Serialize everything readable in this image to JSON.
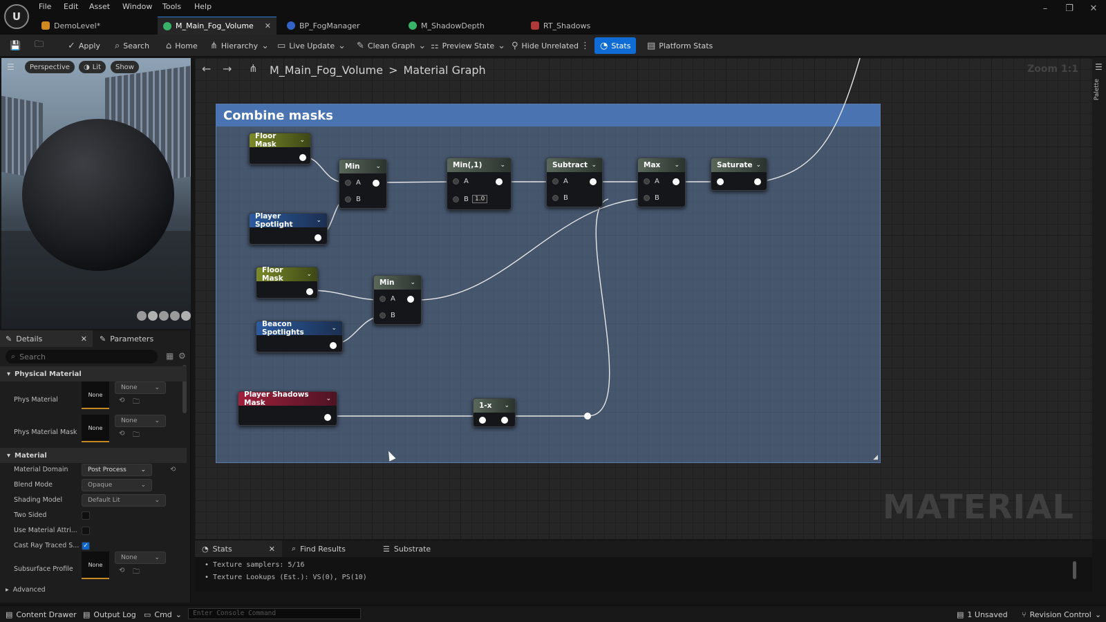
{
  "menu": [
    "File",
    "Edit",
    "Asset",
    "Window",
    "Tools",
    "Help"
  ],
  "tabs": [
    {
      "label": "DemoLevel*",
      "color": "#d08a20",
      "active": false
    },
    {
      "label": "M_Main_Fog_Volume",
      "color": "#39b26a",
      "active": true
    },
    {
      "label": "BP_FogManager",
      "color": "#3264c8",
      "active": false
    },
    {
      "label": "M_ShadowDepth",
      "color": "#39b26a",
      "active": false
    },
    {
      "label": "RT_Shadows",
      "color": "#b03a3a",
      "active": false
    }
  ],
  "toolbar": {
    "apply": "Apply",
    "search": "Search",
    "home": "Home",
    "hierarchy": "Hierarchy",
    "live_update": "Live Update",
    "clean_graph": "Clean Graph",
    "preview_state": "Preview State",
    "hide_unrelated": "Hide Unrelated",
    "stats": "Stats",
    "platform_stats": "Platform Stats"
  },
  "viewport": {
    "perspective": "Perspective",
    "lit": "Lit",
    "show": "Show"
  },
  "details": {
    "tab_details": "Details",
    "tab_parameters": "Parameters",
    "search_placeholder": "Search",
    "section_physical": "Physical Material",
    "phys_material": "Phys Material",
    "phys_material_mask": "Phys Material Mask",
    "none": "None",
    "section_material": "Material",
    "material_domain": "Material Domain",
    "material_domain_value": "Post Process",
    "blend_mode": "Blend Mode",
    "blend_mode_value": "Opaque",
    "shading_model": "Shading Model",
    "shading_model_value": "Default Lit",
    "two_sided": "Two Sided",
    "use_material_attr": "Use Material Attri...",
    "cast_ray_traced": "Cast Ray Traced S...",
    "subsurface_profile": "Subsurface Profile",
    "advanced": "Advanced"
  },
  "graph": {
    "breadcrumb_asset": "M_Main_Fog_Volume",
    "breadcrumb_sep": ">",
    "breadcrumb_view": "Material Graph",
    "zoom": "Zoom 1:1",
    "palette": "Palette",
    "watermark": "MATERIAL",
    "comment_title": "Combine masks",
    "nodes": {
      "floor_mask_1": "Floor Mask",
      "player_spotlight": "Player Spotlight",
      "floor_mask_2": "Floor Mask",
      "beacon_spotlights": "Beacon Spotlights",
      "player_shadows_mask": "Player Shadows Mask",
      "min_1": "Min",
      "min_2": "Min",
      "min_const": "Min(,1)",
      "min_const_b": "1.0",
      "subtract": "Subtract",
      "max": "Max",
      "saturate": "Saturate",
      "one_minus": "1-x",
      "pin_a": "A",
      "pin_b": "B"
    }
  },
  "bottom_tabs": {
    "stats": "Stats",
    "find_results": "Find Results",
    "substrate": "Substrate"
  },
  "stats_lines": [
    "Texture samplers: 5/16",
    "Texture Lookups (Est.): VS(0), PS(10)"
  ],
  "statusbar": {
    "content_drawer": "Content Drawer",
    "output_log": "Output Log",
    "cmd": "Cmd",
    "console_placeholder": "Enter Console Command",
    "unsaved": "1 Unsaved",
    "revision_control": "Revision Control"
  }
}
